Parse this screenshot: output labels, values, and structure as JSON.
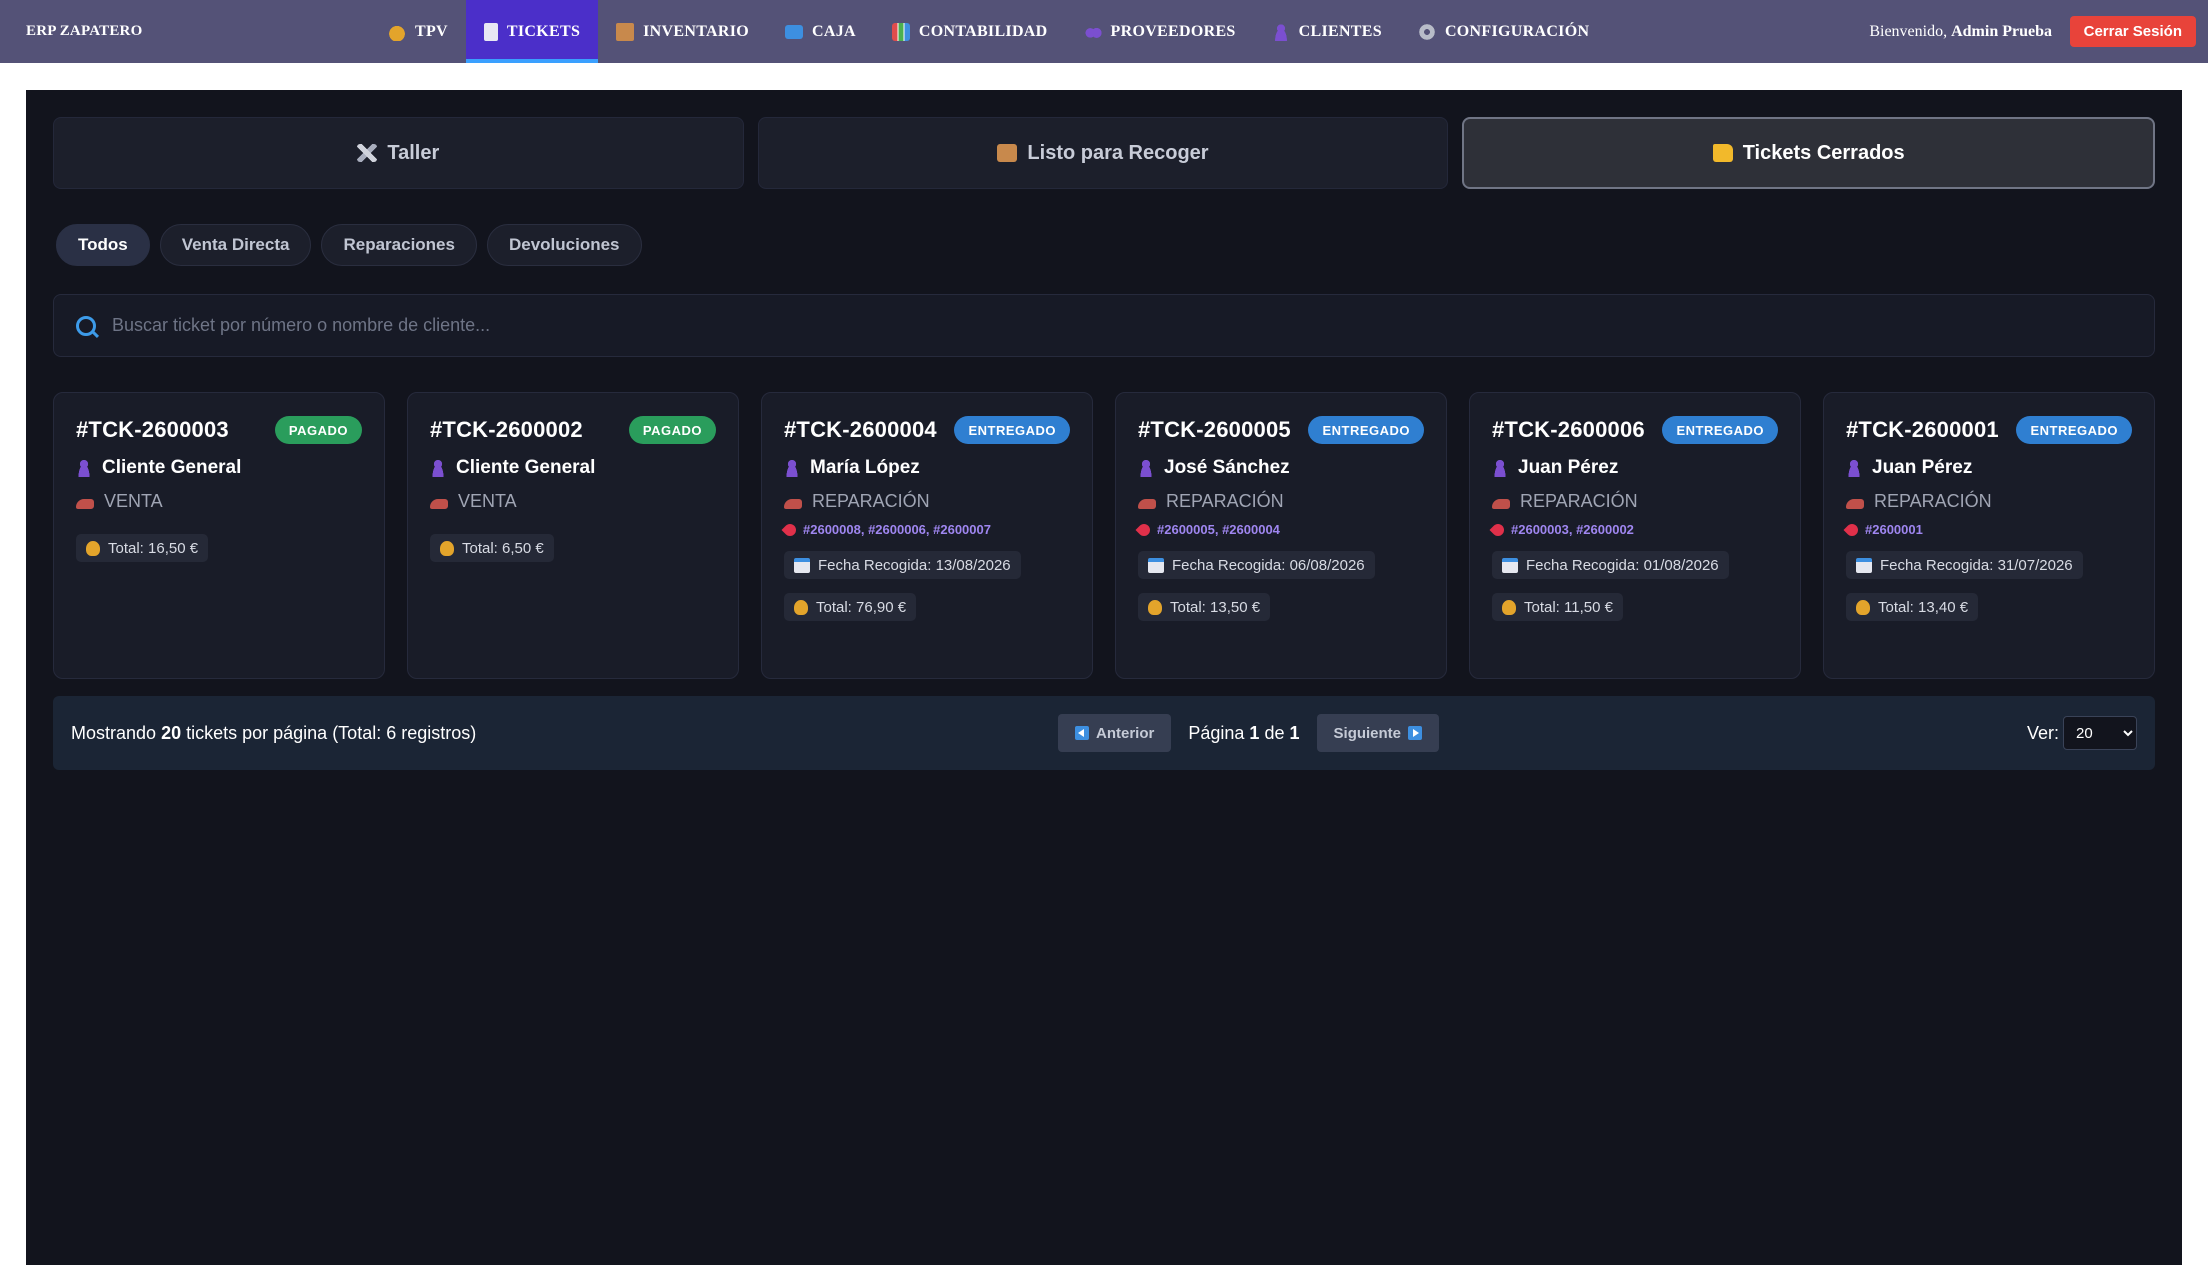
{
  "app": {
    "brand": "ERP ZAPATERO"
  },
  "nav": {
    "items": [
      {
        "label": "TPV",
        "icon": "money-bag-icon"
      },
      {
        "label": "TICKETS",
        "icon": "document-icon",
        "active": true
      },
      {
        "label": "INVENTARIO",
        "icon": "box-icon"
      },
      {
        "label": "CAJA",
        "icon": "atm-icon"
      },
      {
        "label": "CONTABILIDAD",
        "icon": "chart-icon"
      },
      {
        "label": "PROVEEDORES",
        "icon": "people-icon"
      },
      {
        "label": "CLIENTES",
        "icon": "person-icon"
      },
      {
        "label": "CONFIGURACIÓN",
        "icon": "gear-icon"
      }
    ],
    "welcome_prefix": "Bienvenido,",
    "user_name": "Admin Prueba",
    "logout_label": "Cerrar Sesión"
  },
  "tabs": [
    {
      "label": "Taller",
      "icon": "tools-icon"
    },
    {
      "label": "Listo para Recoger",
      "icon": "package-icon"
    },
    {
      "label": "Tickets Cerrados",
      "icon": "folder-icon",
      "active": true
    }
  ],
  "filters": [
    {
      "label": "Todos",
      "active": true
    },
    {
      "label": "Venta Directa"
    },
    {
      "label": "Reparaciones"
    },
    {
      "label": "Devoluciones"
    }
  ],
  "search": {
    "placeholder": "Buscar ticket por número o nombre de cliente..."
  },
  "tickets": [
    {
      "number": "#TCK-2600003",
      "status": "PAGADO",
      "client": "Cliente General",
      "type": "VENTA",
      "refs": "",
      "pickup": "",
      "total": "Total: 16,50 €"
    },
    {
      "number": "#TCK-2600002",
      "status": "PAGADO",
      "client": "Cliente General",
      "type": "VENTA",
      "refs": "",
      "pickup": "",
      "total": "Total: 6,50 €"
    },
    {
      "number": "#TCK-2600004",
      "status": "ENTREGADO",
      "client": "María López",
      "type": "REPARACIÓN",
      "refs": "#2600008, #2600006, #2600007",
      "pickup": "Fecha Recogida: 13/08/2026",
      "total": "Total: 76,90 €"
    },
    {
      "number": "#TCK-2600005",
      "status": "ENTREGADO",
      "client": "José Sánchez",
      "type": "REPARACIÓN",
      "refs": "#2600005, #2600004",
      "pickup": "Fecha Recogida: 06/08/2026",
      "total": "Total: 13,50 €"
    },
    {
      "number": "#TCK-2600006",
      "status": "ENTREGADO",
      "client": "Juan Pérez",
      "type": "REPARACIÓN",
      "refs": "#2600003, #2600002",
      "pickup": "Fecha Recogida: 01/08/2026",
      "total": "Total: 11,50 €"
    },
    {
      "number": "#TCK-2600001",
      "status": "ENTREGADO",
      "client": "Juan Pérez",
      "type": "REPARACIÓN",
      "refs": "#2600001",
      "pickup": "Fecha Recogida: 31/07/2026",
      "total": "Total: 13,40 €"
    }
  ],
  "pager": {
    "info_prefix": "Mostrando",
    "per_page": "20",
    "info_suffix": "tickets por página (Total: 6 registros)",
    "prev_label": "Anterior",
    "page_prefix": "Página",
    "current_page": "1",
    "page_of": "de",
    "total_pages": "1",
    "next_label": "Siguiente",
    "ver_label": "Ver:",
    "ver_value": "20"
  },
  "colors": {
    "nav_bg": "#545277",
    "nav_active": "#4b2fc9",
    "logout": "#e8433a",
    "badge_pagado": "#2a9d5c",
    "badge_entregado": "#2f7fd1",
    "panel_bg": "#12141d"
  }
}
